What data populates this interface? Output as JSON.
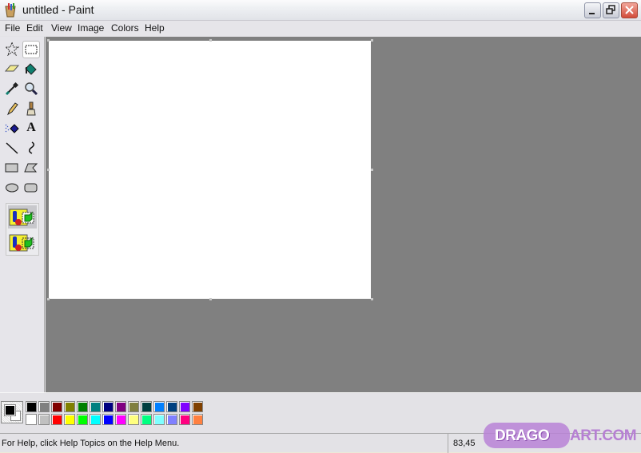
{
  "window": {
    "title": "untitled - Paint",
    "controls": [
      "minimize",
      "restore",
      "close"
    ]
  },
  "menu": [
    "File",
    "Edit",
    "View",
    "Image",
    "Colors",
    "Help"
  ],
  "tools": [
    {
      "name": "free-form-select",
      "icon": "star-select-icon"
    },
    {
      "name": "select",
      "icon": "rect-select-icon",
      "selected": true
    },
    {
      "name": "eraser",
      "icon": "eraser-icon"
    },
    {
      "name": "fill-with-color",
      "icon": "paint-bucket-icon"
    },
    {
      "name": "pick-color",
      "icon": "eyedropper-icon"
    },
    {
      "name": "magnifier",
      "icon": "magnifier-icon"
    },
    {
      "name": "pencil",
      "icon": "pencil-icon"
    },
    {
      "name": "brush",
      "icon": "brush-icon"
    },
    {
      "name": "airbrush",
      "icon": "airbrush-icon"
    },
    {
      "name": "text",
      "icon": "text-icon",
      "glyph": "A"
    },
    {
      "name": "line",
      "icon": "line-icon"
    },
    {
      "name": "curve",
      "icon": "curve-icon"
    },
    {
      "name": "rectangle",
      "icon": "rectangle-icon"
    },
    {
      "name": "polygon",
      "icon": "polygon-icon"
    },
    {
      "name": "ellipse",
      "icon": "ellipse-icon"
    },
    {
      "name": "rounded-rectangle",
      "icon": "rounded-rect-icon"
    }
  ],
  "tool_options": [
    {
      "name": "opaque-selection",
      "selected": true
    },
    {
      "name": "transparent-selection",
      "selected": false
    }
  ],
  "colors": {
    "foreground": "#000000",
    "background": "#ffffff",
    "palette_top": [
      "#000000",
      "#808080",
      "#800000",
      "#808000",
      "#008000",
      "#008080",
      "#000080",
      "#800080",
      "#808040",
      "#004040",
      "#0080ff",
      "#004080",
      "#8000ff",
      "#804000"
    ],
    "palette_bottom": [
      "#ffffff",
      "#c0c0c0",
      "#ff0000",
      "#ffff00",
      "#00ff00",
      "#00ffff",
      "#0000ff",
      "#ff00ff",
      "#ffff80",
      "#00ff80",
      "#80ffff",
      "#8080ff",
      "#ff0080",
      "#ff8040"
    ]
  },
  "status": {
    "help_text": "For Help, click Help Topics on the Help Menu.",
    "coords": "83,45"
  },
  "watermark": {
    "part1": "DRAGO",
    "part2": "ART.COM"
  }
}
